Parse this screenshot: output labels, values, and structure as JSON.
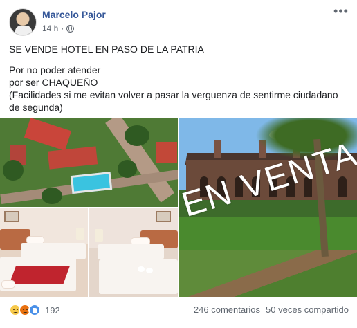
{
  "post": {
    "author": "Marcelo Pajor",
    "time": "14 h",
    "separator": "·",
    "privacy_icon": "globe-icon",
    "more_icon": "more-options-icon",
    "text": {
      "line1": "SE VENDE HOTEL EN PASO DE LA PATRIA",
      "line2": "Por no poder atender",
      "line3": "por ser CHAQUEÑO",
      "line4": "(Facilidades si me evitan volver a pasar la verguenza de sentirme ciudadano de segunda)"
    },
    "images": {
      "overlay_text": "EN VENTA",
      "items": [
        "aerial-view",
        "hotel-building",
        "room-red-runner",
        "room-twin-beds"
      ]
    },
    "footer": {
      "reactions": [
        "sad-reaction-icon",
        "angry-reaction-icon",
        "like-reaction-icon"
      ],
      "reaction_count": "192",
      "comments": "246 comentarios",
      "shares": "50 veces compartido"
    },
    "colors": {
      "author": "#365899",
      "meta": "#606770",
      "like": "#4a90e8",
      "angry": "#e9710f",
      "sad": "#f7c94b"
    }
  }
}
